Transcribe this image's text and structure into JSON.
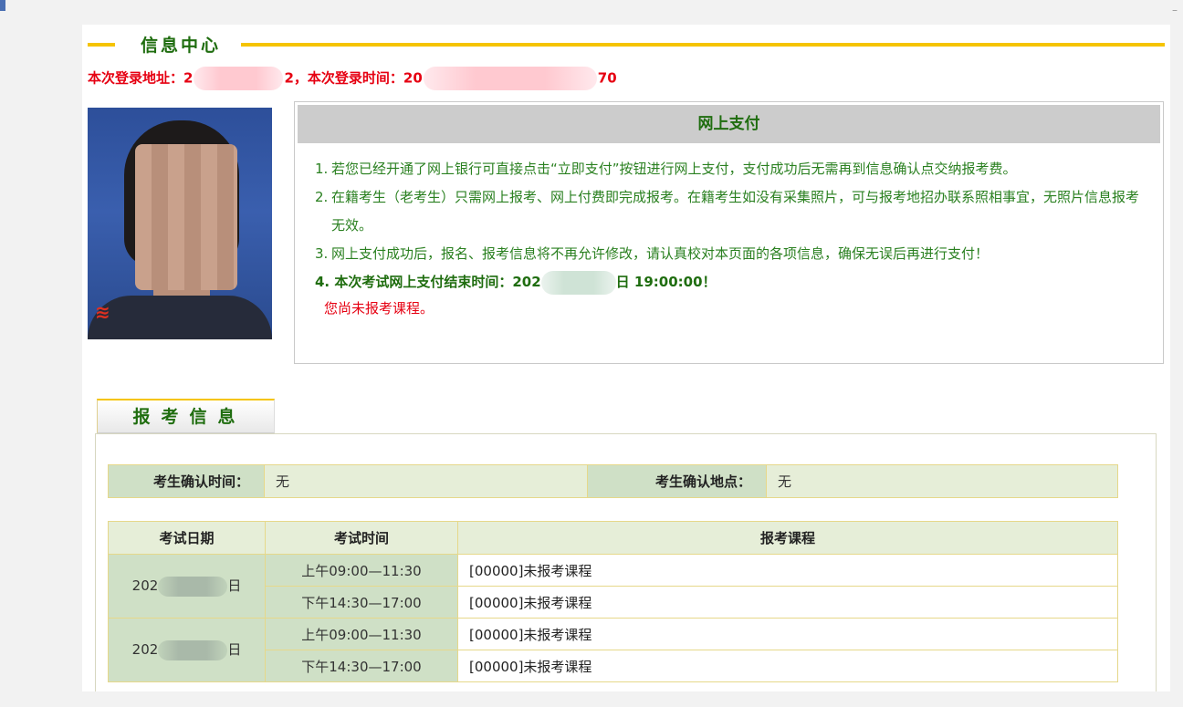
{
  "section": {
    "title": "信息中心"
  },
  "login": {
    "address_prefix": "本次登录地址：2",
    "address_suffix": "2，本次登录时间：20",
    "time_suffix": "70"
  },
  "payment": {
    "title": "网上支付",
    "items": [
      {
        "num": "1.",
        "text": "若您已经开通了网上银行可直接点击“立即支付”按钮进行网上支付，支付成功后无需再到信息确认点交纳报考费。"
      },
      {
        "num": "2.",
        "text": "在籍考生（老考生）只需网上报考、网上付费即完成报考。在籍考生如没有采集照片，可与报考地招办联系照相事宜，无照片信息报考无效。"
      },
      {
        "num": "3.",
        "text": "网上支付成功后，报名、报考信息将不再允许修改，请认真校对本页面的各项信息，确保无误后再进行支付！"
      }
    ],
    "deadline_prefix": "4. 本次考试网上支付结束时间：202",
    "deadline_suffix": "日 19:00:00！",
    "notice": "您尚未报考课程。"
  },
  "tab": {
    "label": "报考信息"
  },
  "confirm": {
    "time_label": "考生确认时间：",
    "time_value": "无",
    "place_label": "考生确认地点：",
    "place_value": "无"
  },
  "exam": {
    "headers": [
      "考试日期",
      "考试时间",
      "报考课程"
    ],
    "rows": [
      {
        "date_prefix": "202",
        "date_suffix": "日",
        "sessions": [
          {
            "time": "上午09:00—11:30",
            "course": "[00000]未报考课程"
          },
          {
            "time": "下午14:30—17:00",
            "course": "[00000]未报考课程"
          }
        ]
      },
      {
        "date_prefix": "202",
        "date_suffix": "日",
        "sessions": [
          {
            "time": "上午09:00—11:30",
            "course": "[00000]未报考课程"
          },
          {
            "time": "下午14:30—17:00",
            "course": "[00000]未报考课程"
          }
        ]
      }
    ]
  }
}
